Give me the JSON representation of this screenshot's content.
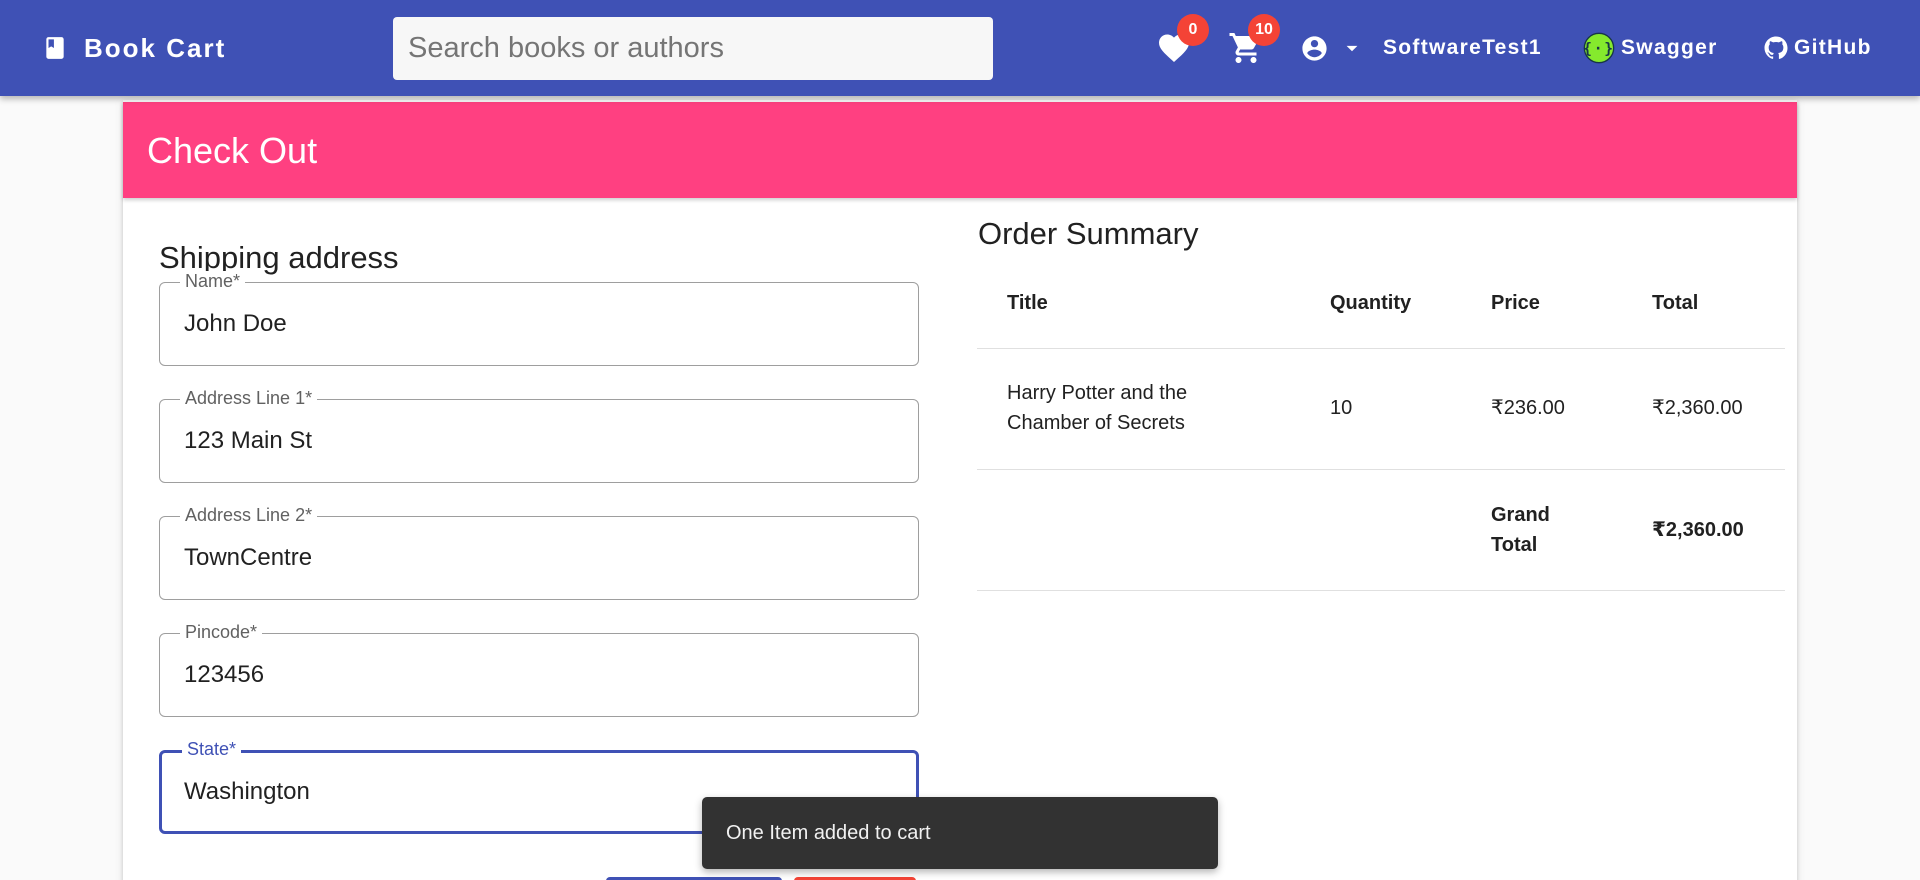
{
  "header": {
    "brand": "Book Cart",
    "search_placeholder": "Search books or authors",
    "wishlist_count": "0",
    "cart_count": "10",
    "username": "SoftwareTest1",
    "swagger_label": "Swagger",
    "github_label": "GitHub"
  },
  "checkout": {
    "title": "Check Out",
    "shipping": {
      "heading": "Shipping address",
      "fields": [
        {
          "label": "Name*",
          "value": "John Doe"
        },
        {
          "label": "Address Line 1*",
          "value": "123 Main St"
        },
        {
          "label": "Address Line 2*",
          "value": "TownCentre"
        },
        {
          "label": "Pincode*",
          "value": "123456"
        },
        {
          "label": "State*",
          "value": "Washington"
        }
      ]
    },
    "summary": {
      "heading": "Order Summary",
      "columns": [
        "Title",
        "Quantity",
        "Price",
        "Total"
      ],
      "rows": [
        {
          "title_line1": "Harry Potter and the",
          "title_line2": "Chamber of Secrets",
          "quantity": "10",
          "price": "₹236.00",
          "total": "₹2,360.00"
        }
      ],
      "grand_total_label_line1": "Grand",
      "grand_total_label_line2": "Total",
      "grand_total": "₹2,360.00"
    }
  },
  "snackbar": {
    "message": "One Item added to cart"
  },
  "icons": {
    "brand": "book-icon",
    "wishlist": "heart-icon",
    "cart": "shopping-cart-icon",
    "account": "account-circle-icon",
    "dropdown": "arrow-drop-down-icon",
    "swagger": "swagger-logo-icon",
    "github": "github-logo-icon"
  },
  "colors": {
    "toolbar": "#3f51b5",
    "accent": "#ff4081",
    "badge": "#f44336",
    "swagger_green": "#85ea2d",
    "snackbar": "#323232"
  }
}
